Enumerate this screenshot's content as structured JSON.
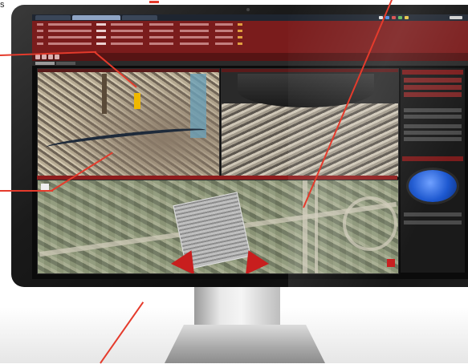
{
  "caption_fragment": "s",
  "colors": {
    "callout": "#e53b2c",
    "table_red": "#7a1c1c",
    "ptz_blue": "#1d58d0"
  },
  "screen": {
    "title_tabs": [
      "tab-1",
      "tab-2",
      "tab-3"
    ],
    "table_rows": 5,
    "panels": [
      "camera-feed-1",
      "camera-feed-2",
      "aerial-map"
    ],
    "sidebar_controls": [
      "ptz-pad"
    ]
  }
}
